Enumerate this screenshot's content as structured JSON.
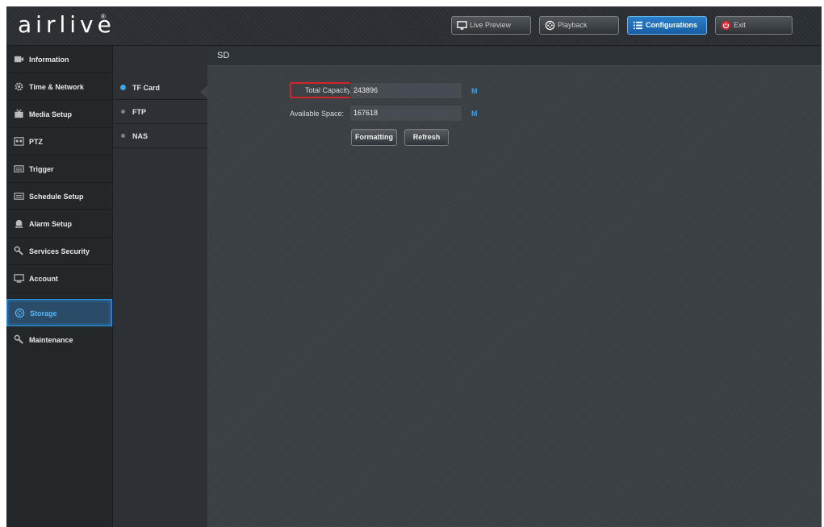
{
  "header": {
    "logo": "airlive",
    "logo_mark": "®",
    "nav": [
      {
        "label": "Live Preview",
        "icon": "monitor-icon"
      },
      {
        "label": "Playback",
        "icon": "film-reel-icon"
      },
      {
        "label": "Configurations",
        "icon": "list-icon",
        "active": true
      },
      {
        "label": "Exit",
        "icon": "power-icon"
      }
    ]
  },
  "sidebar": {
    "items": [
      {
        "label": "Information",
        "icon": "camera-icon"
      },
      {
        "label": "Time & Network",
        "icon": "gear-icon"
      },
      {
        "label": "Media Setup",
        "icon": "media-box-icon"
      },
      {
        "label": "PTZ",
        "icon": "ptz-icon"
      },
      {
        "label": "Trigger",
        "icon": "trigger-icon"
      },
      {
        "label": "Schedule Setup",
        "icon": "schedule-icon"
      },
      {
        "label": "Alarm Setup",
        "icon": "alarm-icon"
      },
      {
        "label": "Services Security",
        "icon": "wrench-icon"
      },
      {
        "label": "Account",
        "icon": "monitor-icon"
      },
      {
        "label": "Storage",
        "icon": "storage-icon",
        "active": true
      },
      {
        "label": "Maintenance",
        "icon": "tools-icon"
      }
    ]
  },
  "submenu": {
    "items": [
      {
        "label": "TF Card",
        "active": true
      },
      {
        "label": "FTP"
      },
      {
        "label": "NAS"
      }
    ]
  },
  "content": {
    "title": "SD",
    "total_capacity": {
      "label": "Total Capacity:",
      "value": "243896",
      "unit": "M"
    },
    "available_space": {
      "label": "Available Space:",
      "value": "167618",
      "unit": "M"
    },
    "buttons": {
      "format": "Formatting",
      "refresh": "Refresh"
    }
  },
  "colors": {
    "accent": "#2a8fd8",
    "highlight_box": "#d6232a",
    "unit_text": "#38a2ec",
    "sidebar_bg": "#24272a",
    "content_bg": "#3a3f44"
  }
}
